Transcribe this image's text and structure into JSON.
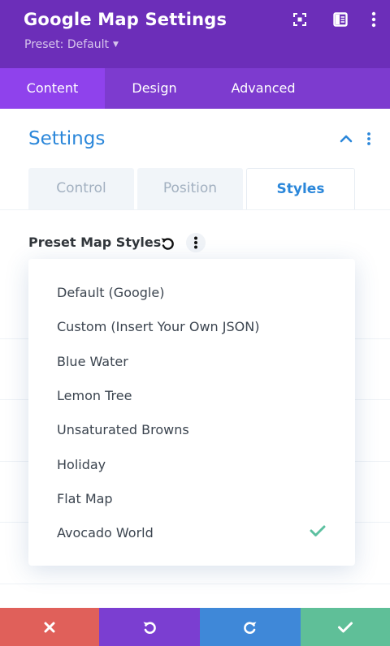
{
  "header": {
    "title": "Google Map Settings",
    "preset": "Preset: Default",
    "icons": [
      "focus-icon",
      "sidebar-layout-icon",
      "more-vertical-icon"
    ]
  },
  "tabs": [
    {
      "label": "Content",
      "active": true
    },
    {
      "label": "Design",
      "active": false
    },
    {
      "label": "Advanced",
      "active": false
    }
  ],
  "section": {
    "title": "Settings",
    "subtabs": [
      {
        "label": "Control",
        "active": false
      },
      {
        "label": "Position",
        "active": false
      },
      {
        "label": "Styles",
        "active": true
      }
    ]
  },
  "field": {
    "label": "Preset Map Styles"
  },
  "dropdown": {
    "options": [
      {
        "label": "Default (Google)",
        "selected": false
      },
      {
        "label": "Custom (Insert Your Own JSON)",
        "selected": false
      },
      {
        "label": "Blue Water",
        "selected": false
      },
      {
        "label": "Lemon Tree",
        "selected": false
      },
      {
        "label": "Unsaturated Browns",
        "selected": false
      },
      {
        "label": "Holiday",
        "selected": false
      },
      {
        "label": "Flat Map",
        "selected": false
      },
      {
        "label": "Avocado World",
        "selected": true
      }
    ]
  },
  "footer": {
    "buttons": [
      "close-icon",
      "undo-icon",
      "redo-icon",
      "checkmark-icon"
    ]
  },
  "colors": {
    "header": "#6c2eb9",
    "tabs": "#7d3bcf",
    "active_tab": "#8f42ec",
    "accent": "#2b87da",
    "check": "#5cc0a0",
    "cancel": "#e0605a",
    "undo": "#7b3ed1",
    "redo": "#3f88d8",
    "save": "#5fbf98"
  }
}
